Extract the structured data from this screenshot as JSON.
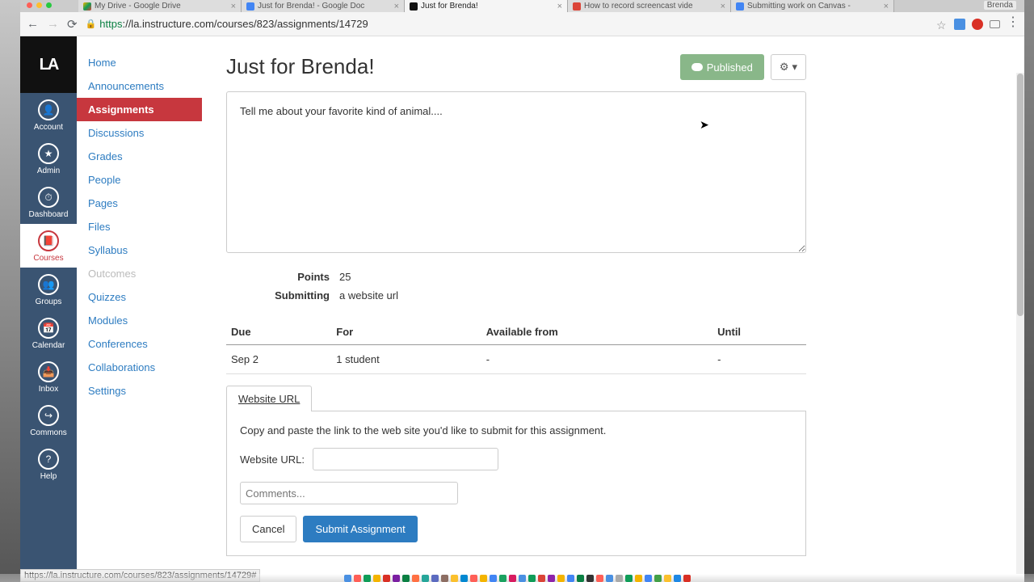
{
  "browser": {
    "user_badge": "Brenda",
    "tabs": [
      {
        "label": "My Drive - Google Drive",
        "fav": "fav-drive",
        "active": false
      },
      {
        "label": "Just for Brenda! - Google Doc",
        "fav": "fav-doc",
        "active": false
      },
      {
        "label": "Just for Brenda!",
        "fav": "fav-la",
        "active": true
      },
      {
        "label": "How to record screencast vide",
        "fav": "fav-red",
        "active": false
      },
      {
        "label": "Submitting work on Canvas -",
        "fav": "fav-doc",
        "active": false
      }
    ],
    "url_proto": "https",
    "url_rest": "://la.instructure.com/courses/823/assignments/14729",
    "status_link": "https://la.instructure.com/courses/823/assignments/14729#"
  },
  "globalnav": [
    {
      "label": "Account",
      "icon": "👤"
    },
    {
      "label": "Admin",
      "icon": "★"
    },
    {
      "label": "Dashboard",
      "icon": "⏱"
    },
    {
      "label": "Courses",
      "icon": "📕",
      "active": true
    },
    {
      "label": "Groups",
      "icon": "👥"
    },
    {
      "label": "Calendar",
      "icon": "📅"
    },
    {
      "label": "Inbox",
      "icon": "📥"
    },
    {
      "label": "Commons",
      "icon": "↪"
    },
    {
      "label": "Help",
      "icon": "?"
    }
  ],
  "coursenav": [
    {
      "label": "Home"
    },
    {
      "label": "Announcements"
    },
    {
      "label": "Assignments",
      "active": true
    },
    {
      "label": "Discussions"
    },
    {
      "label": "Grades"
    },
    {
      "label": "People"
    },
    {
      "label": "Pages"
    },
    {
      "label": "Files"
    },
    {
      "label": "Syllabus"
    },
    {
      "label": "Outcomes",
      "disabled": true
    },
    {
      "label": "Quizzes"
    },
    {
      "label": "Modules"
    },
    {
      "label": "Conferences"
    },
    {
      "label": "Collaborations"
    },
    {
      "label": "Settings"
    }
  ],
  "assignment": {
    "title": "Just for Brenda!",
    "published_label": "Published",
    "description": "Tell me about your favorite kind of animal....",
    "points_label": "Points",
    "points_value": "25",
    "submitting_label": "Submitting",
    "submitting_value": "a website url",
    "due_headers": {
      "due": "Due",
      "for": "For",
      "from": "Available from",
      "until": "Until"
    },
    "due_row": {
      "due": "Sep 2",
      "for": "1 student",
      "from": "-",
      "until": "-"
    },
    "tab_label": "Website URL",
    "panel_text": "Copy and paste the link to the web site you'd like to submit for this assignment.",
    "url_label": "Website URL:",
    "comments_placeholder": "Comments...",
    "cancel": "Cancel",
    "submit": "Submit Assignment"
  },
  "dock_colors": [
    "#4a90e2",
    "#ff5f57",
    "#0f9d58",
    "#f4b400",
    "#d93025",
    "#7b1fa2",
    "#0b8043",
    "#ff7043",
    "#26a69a",
    "#5c6bc0",
    "#8d6e63",
    "#fbc02d",
    "#0288d1",
    "#ff5f57",
    "#f4b400",
    "#4285f4",
    "#1aa260",
    "#d81b60",
    "#4a90e2",
    "#0f9d58",
    "#db4437",
    "#8e24aa",
    "#f4b400",
    "#4285f4",
    "#0b8043",
    "#333",
    "#ff5f57",
    "#4a90e2",
    "#aaa",
    "#0f9d58",
    "#f4b400",
    "#4285f4",
    "#43a047",
    "#fbc02d",
    "#1e88e5",
    "#d93025"
  ]
}
